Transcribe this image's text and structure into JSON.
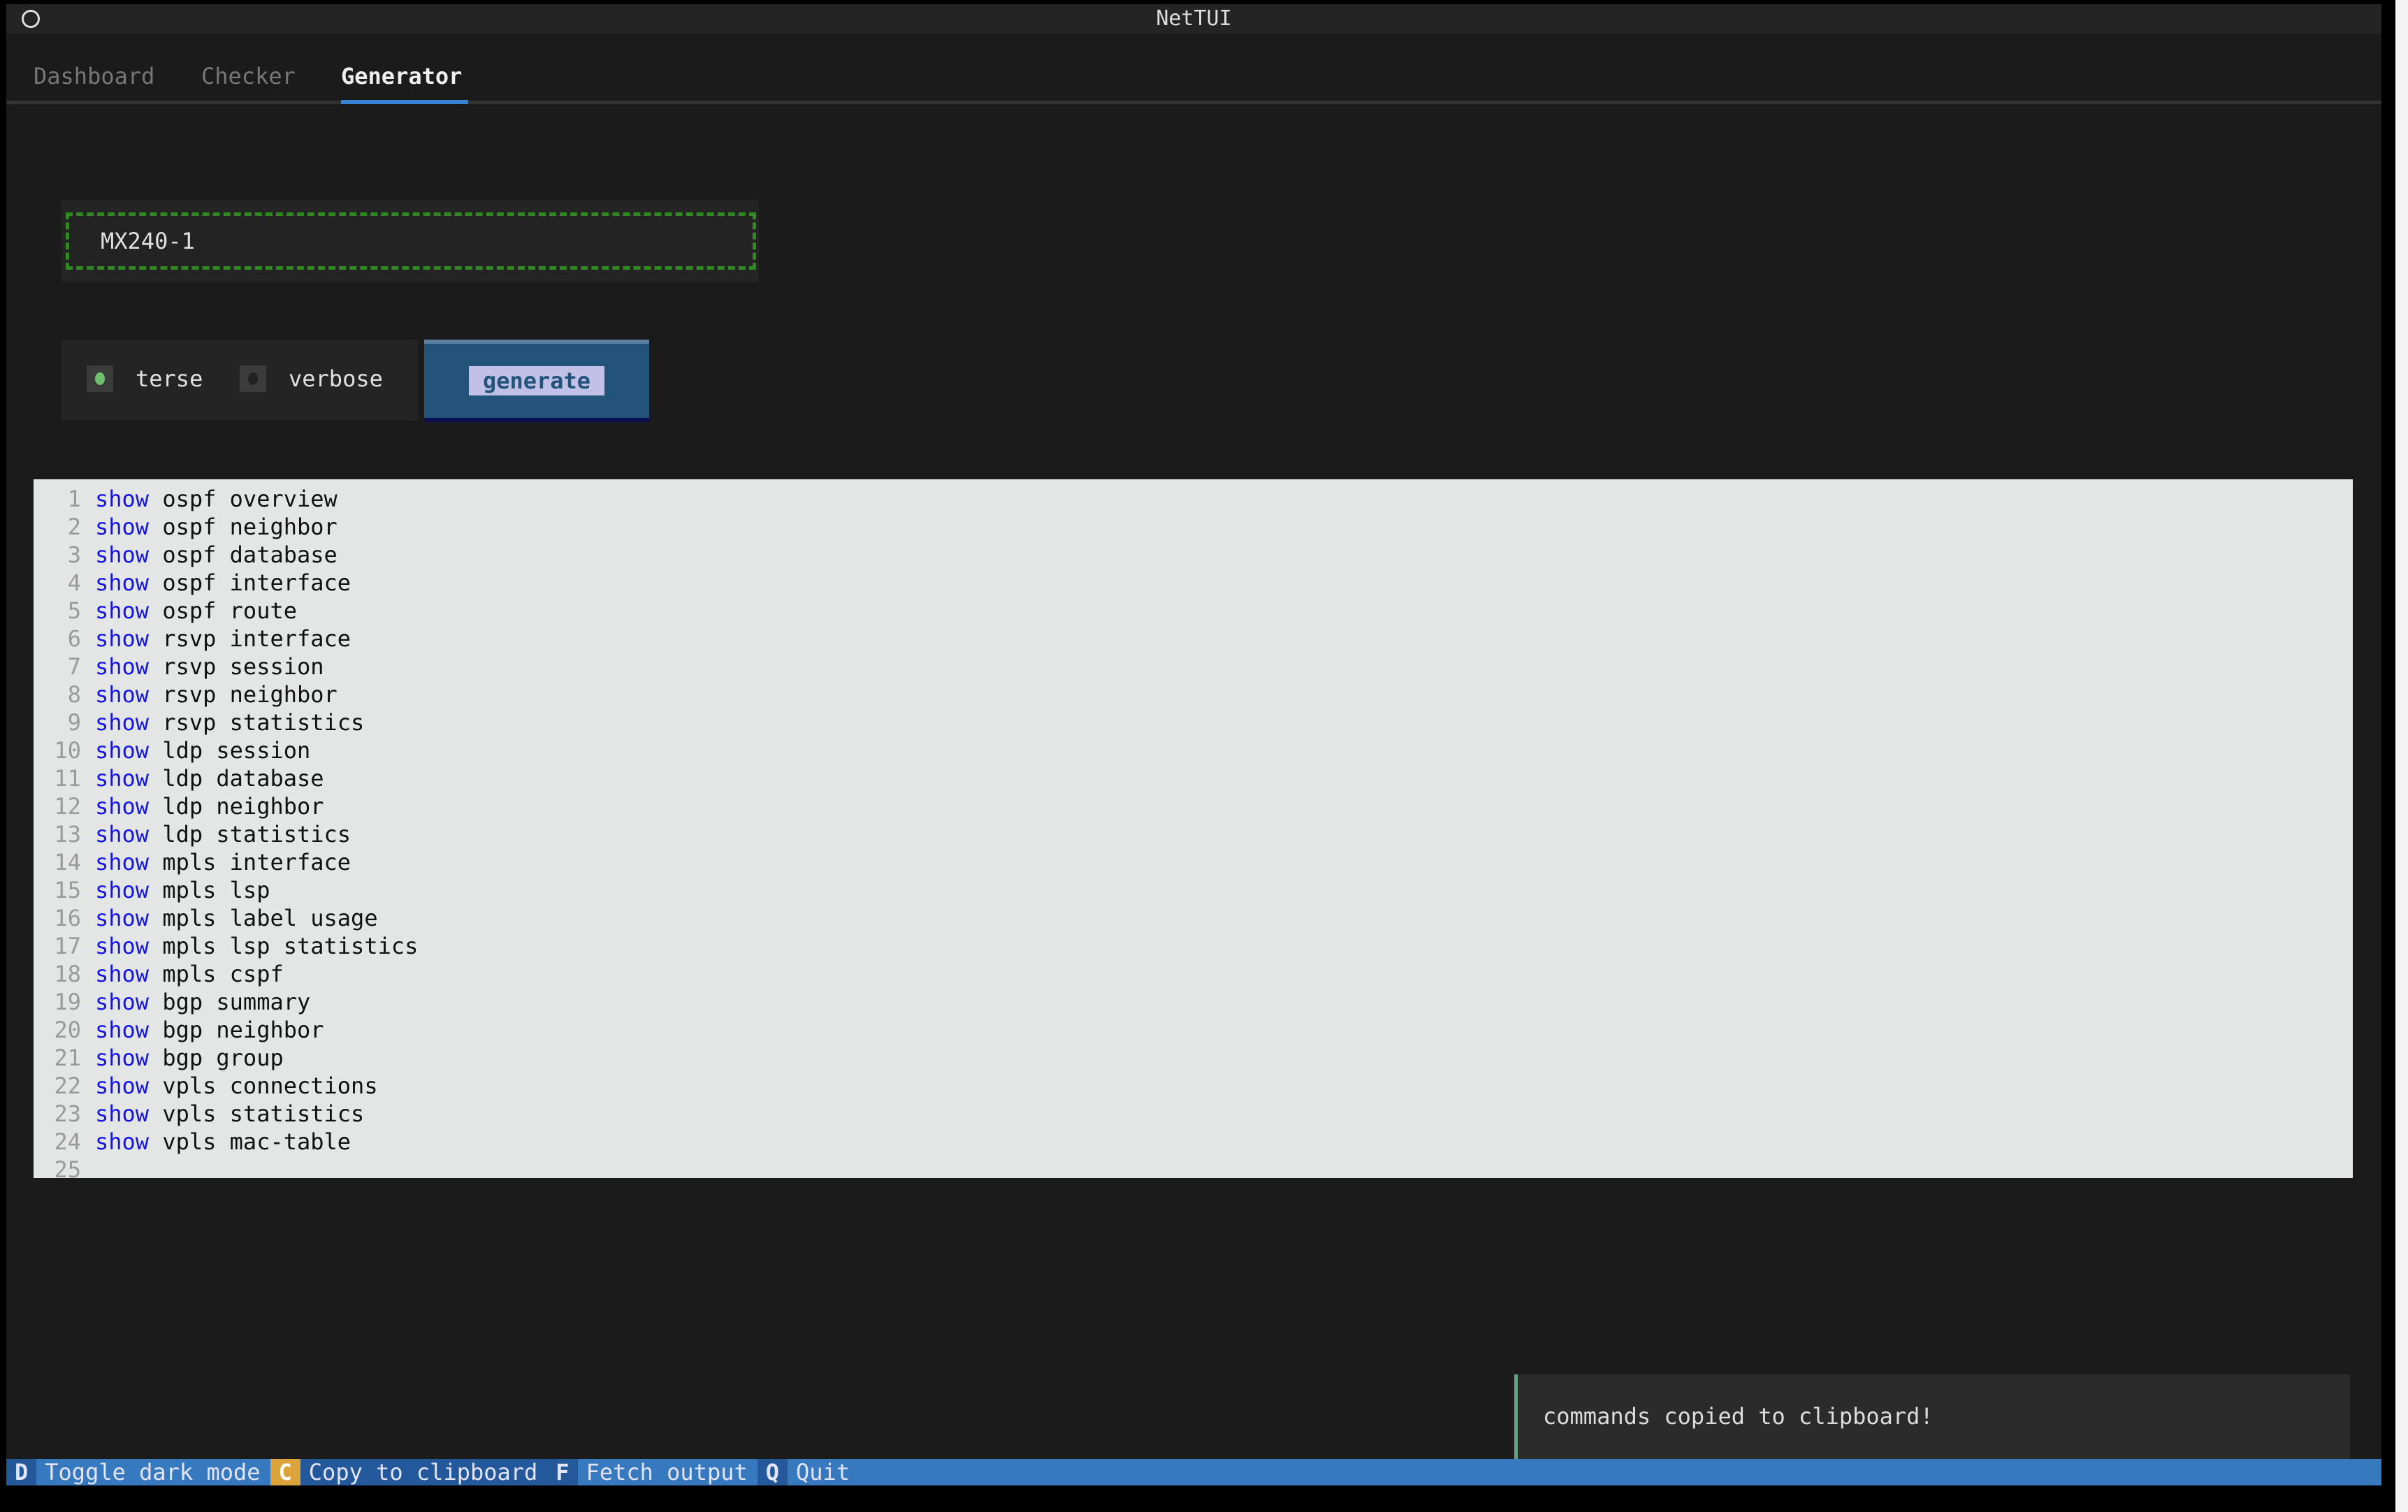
{
  "window": {
    "title": "NetTUI"
  },
  "tabs": [
    {
      "label": "Dashboard",
      "active": false
    },
    {
      "label": "Checker",
      "active": false
    },
    {
      "label": "Generator",
      "active": true
    }
  ],
  "device_input": {
    "value": "MX240-1"
  },
  "mode": {
    "options": [
      {
        "label": "terse",
        "selected": true
      },
      {
        "label": "verbose",
        "selected": false
      }
    ]
  },
  "generate_button": {
    "label": "generate"
  },
  "commands": [
    {
      "n": "1",
      "kw": "show",
      "rest": " ospf overview"
    },
    {
      "n": "2",
      "kw": "show",
      "rest": " ospf neighbor"
    },
    {
      "n": "3",
      "kw": "show",
      "rest": " ospf database"
    },
    {
      "n": "4",
      "kw": "show",
      "rest": " ospf interface"
    },
    {
      "n": "5",
      "kw": "show",
      "rest": " ospf route"
    },
    {
      "n": "6",
      "kw": "show",
      "rest": " rsvp interface"
    },
    {
      "n": "7",
      "kw": "show",
      "rest": " rsvp session"
    },
    {
      "n": "8",
      "kw": "show",
      "rest": " rsvp neighbor"
    },
    {
      "n": "9",
      "kw": "show",
      "rest": " rsvp statistics"
    },
    {
      "n": "10",
      "kw": "show",
      "rest": " ldp session"
    },
    {
      "n": "11",
      "kw": "show",
      "rest": " ldp database"
    },
    {
      "n": "12",
      "kw": "show",
      "rest": " ldp neighbor"
    },
    {
      "n": "13",
      "kw": "show",
      "rest": " ldp statistics"
    },
    {
      "n": "14",
      "kw": "show",
      "rest": " mpls interface"
    },
    {
      "n": "15",
      "kw": "show",
      "rest": " mpls lsp"
    },
    {
      "n": "16",
      "kw": "show",
      "rest": " mpls label usage"
    },
    {
      "n": "17",
      "kw": "show",
      "rest": " mpls lsp statistics"
    },
    {
      "n": "18",
      "kw": "show",
      "rest": " mpls cspf"
    },
    {
      "n": "19",
      "kw": "show",
      "rest": " bgp summary"
    },
    {
      "n": "20",
      "kw": "show",
      "rest": " bgp neighbor"
    },
    {
      "n": "21",
      "kw": "show",
      "rest": " bgp group"
    },
    {
      "n": "22",
      "kw": "show",
      "rest": " vpls connections"
    },
    {
      "n": "23",
      "kw": "show",
      "rest": " vpls statistics"
    },
    {
      "n": "24",
      "kw": "show",
      "rest": " vpls mac-table"
    },
    {
      "n": "25",
      "kw": "",
      "rest": ""
    }
  ],
  "toast": {
    "message": "commands copied to clipboard!"
  },
  "footer": {
    "bindings": [
      {
        "key": "D",
        "label": "Toggle dark mode",
        "highlight": false
      },
      {
        "key": "C",
        "label": "Copy to clipboard",
        "highlight": true
      },
      {
        "key": "F",
        "label": "Fetch output",
        "highlight": false
      },
      {
        "key": "Q",
        "label": "Quit",
        "highlight": false
      }
    ]
  },
  "colors": {
    "accent": "#3a84d6",
    "keyword": "#1515e8",
    "input_border": "#2f8a1f",
    "footer": "#3679be",
    "footer_key_highlight": "#dca33a",
    "radio_on": "#6fbf6f"
  }
}
